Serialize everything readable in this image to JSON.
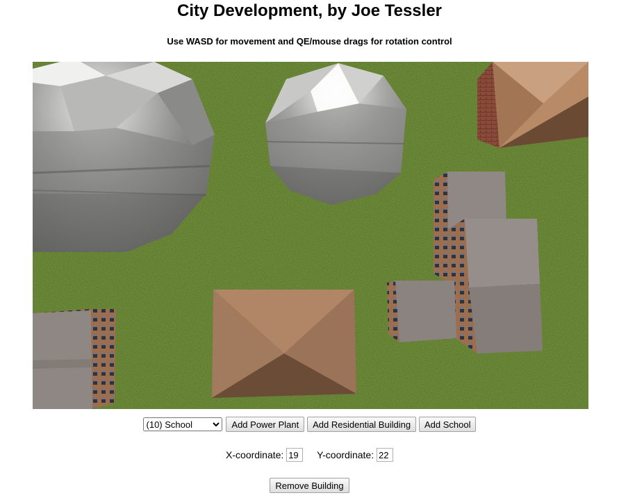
{
  "page": {
    "title": "City Development, by Joe Tessler",
    "instructions": "Use WASD for movement and QE/mouse drags for rotation control"
  },
  "toolbar": {
    "building_select": {
      "selected": "(10) School",
      "options": [
        "(10) School"
      ]
    },
    "add_power_plant_label": "Add Power Plant",
    "add_residential_label": "Add Residential Building",
    "add_school_label": "Add School"
  },
  "coordinates": {
    "x_label": "X-coordinate:",
    "x_value": "19",
    "y_label": "Y-coordinate:",
    "y_value": "22"
  },
  "actions": {
    "remove_label": "Remove Building"
  },
  "scene": {
    "ground_color": "#5f7a2c",
    "objects": [
      "power-plant-sphere",
      "power-plant-sphere",
      "residential-building",
      "residential-building",
      "school-building",
      "school-building",
      "residential-building"
    ]
  }
}
